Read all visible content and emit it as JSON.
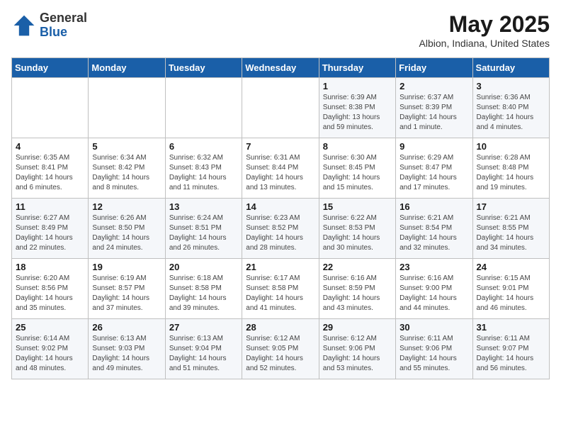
{
  "header": {
    "logo": {
      "general": "General",
      "blue": "Blue"
    },
    "title": "May 2025",
    "location": "Albion, Indiana, United States"
  },
  "weekdays": [
    "Sunday",
    "Monday",
    "Tuesday",
    "Wednesday",
    "Thursday",
    "Friday",
    "Saturday"
  ],
  "weeks": [
    [
      {
        "day": "",
        "content": ""
      },
      {
        "day": "",
        "content": ""
      },
      {
        "day": "",
        "content": ""
      },
      {
        "day": "",
        "content": ""
      },
      {
        "day": "1",
        "content": "Sunrise: 6:39 AM\nSunset: 8:38 PM\nDaylight: 13 hours and 59 minutes."
      },
      {
        "day": "2",
        "content": "Sunrise: 6:37 AM\nSunset: 8:39 PM\nDaylight: 14 hours and 1 minute."
      },
      {
        "day": "3",
        "content": "Sunrise: 6:36 AM\nSunset: 8:40 PM\nDaylight: 14 hours and 4 minutes."
      }
    ],
    [
      {
        "day": "4",
        "content": "Sunrise: 6:35 AM\nSunset: 8:41 PM\nDaylight: 14 hours and 6 minutes."
      },
      {
        "day": "5",
        "content": "Sunrise: 6:34 AM\nSunset: 8:42 PM\nDaylight: 14 hours and 8 minutes."
      },
      {
        "day": "6",
        "content": "Sunrise: 6:32 AM\nSunset: 8:43 PM\nDaylight: 14 hours and 11 minutes."
      },
      {
        "day": "7",
        "content": "Sunrise: 6:31 AM\nSunset: 8:44 PM\nDaylight: 14 hours and 13 minutes."
      },
      {
        "day": "8",
        "content": "Sunrise: 6:30 AM\nSunset: 8:45 PM\nDaylight: 14 hours and 15 minutes."
      },
      {
        "day": "9",
        "content": "Sunrise: 6:29 AM\nSunset: 8:47 PM\nDaylight: 14 hours and 17 minutes."
      },
      {
        "day": "10",
        "content": "Sunrise: 6:28 AM\nSunset: 8:48 PM\nDaylight: 14 hours and 19 minutes."
      }
    ],
    [
      {
        "day": "11",
        "content": "Sunrise: 6:27 AM\nSunset: 8:49 PM\nDaylight: 14 hours and 22 minutes."
      },
      {
        "day": "12",
        "content": "Sunrise: 6:26 AM\nSunset: 8:50 PM\nDaylight: 14 hours and 24 minutes."
      },
      {
        "day": "13",
        "content": "Sunrise: 6:24 AM\nSunset: 8:51 PM\nDaylight: 14 hours and 26 minutes."
      },
      {
        "day": "14",
        "content": "Sunrise: 6:23 AM\nSunset: 8:52 PM\nDaylight: 14 hours and 28 minutes."
      },
      {
        "day": "15",
        "content": "Sunrise: 6:22 AM\nSunset: 8:53 PM\nDaylight: 14 hours and 30 minutes."
      },
      {
        "day": "16",
        "content": "Sunrise: 6:21 AM\nSunset: 8:54 PM\nDaylight: 14 hours and 32 minutes."
      },
      {
        "day": "17",
        "content": "Sunrise: 6:21 AM\nSunset: 8:55 PM\nDaylight: 14 hours and 34 minutes."
      }
    ],
    [
      {
        "day": "18",
        "content": "Sunrise: 6:20 AM\nSunset: 8:56 PM\nDaylight: 14 hours and 35 minutes."
      },
      {
        "day": "19",
        "content": "Sunrise: 6:19 AM\nSunset: 8:57 PM\nDaylight: 14 hours and 37 minutes."
      },
      {
        "day": "20",
        "content": "Sunrise: 6:18 AM\nSunset: 8:58 PM\nDaylight: 14 hours and 39 minutes."
      },
      {
        "day": "21",
        "content": "Sunrise: 6:17 AM\nSunset: 8:58 PM\nDaylight: 14 hours and 41 minutes."
      },
      {
        "day": "22",
        "content": "Sunrise: 6:16 AM\nSunset: 8:59 PM\nDaylight: 14 hours and 43 minutes."
      },
      {
        "day": "23",
        "content": "Sunrise: 6:16 AM\nSunset: 9:00 PM\nDaylight: 14 hours and 44 minutes."
      },
      {
        "day": "24",
        "content": "Sunrise: 6:15 AM\nSunset: 9:01 PM\nDaylight: 14 hours and 46 minutes."
      }
    ],
    [
      {
        "day": "25",
        "content": "Sunrise: 6:14 AM\nSunset: 9:02 PM\nDaylight: 14 hours and 48 minutes."
      },
      {
        "day": "26",
        "content": "Sunrise: 6:13 AM\nSunset: 9:03 PM\nDaylight: 14 hours and 49 minutes."
      },
      {
        "day": "27",
        "content": "Sunrise: 6:13 AM\nSunset: 9:04 PM\nDaylight: 14 hours and 51 minutes."
      },
      {
        "day": "28",
        "content": "Sunrise: 6:12 AM\nSunset: 9:05 PM\nDaylight: 14 hours and 52 minutes."
      },
      {
        "day": "29",
        "content": "Sunrise: 6:12 AM\nSunset: 9:06 PM\nDaylight: 14 hours and 53 minutes."
      },
      {
        "day": "30",
        "content": "Sunrise: 6:11 AM\nSunset: 9:06 PM\nDaylight: 14 hours and 55 minutes."
      },
      {
        "day": "31",
        "content": "Sunrise: 6:11 AM\nSunset: 9:07 PM\nDaylight: 14 hours and 56 minutes."
      }
    ]
  ]
}
